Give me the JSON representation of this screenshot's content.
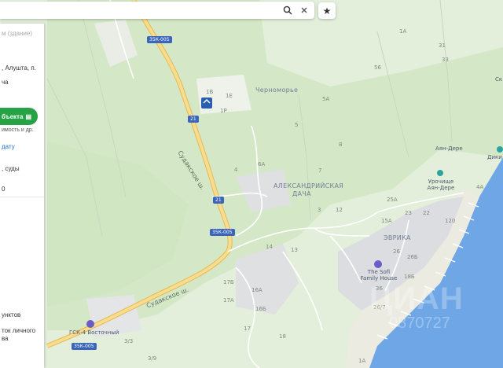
{
  "search": {
    "value": "",
    "placeholder": ""
  },
  "panel": {
    "address_placeholder": "м (здание)",
    "address_line1": ", Алушта, п.",
    "address_line2": "ча",
    "cta_label": "бъекта",
    "cta_sub": "имость и др.",
    "link_date": "дату",
    "courts_line": ", суды",
    "zero": "0",
    "bottom1": "унктов",
    "bottom2": "ток личного",
    "bottom3": "ва"
  },
  "map": {
    "areas": [
      "Черноморье",
      "АЛЕКСАНДРИЙСКАЯ",
      "ДАЧА",
      "ЭВРИКА"
    ],
    "streets": [
      "Судакское ш.",
      "Судакское ш.",
      "Судакское ш."
    ],
    "highways": [
      "35К-005",
      "35К-005",
      "35К-005",
      "21",
      "21"
    ],
    "pois": [
      {
        "name": "Аян-Дере"
      },
      {
        "name": "Урочище Аян-Дере"
      },
      {
        "name": "The Sofi Family House"
      },
      {
        "name": "ГСК-4 Восточный"
      },
      {
        "name": "Дики"
      },
      {
        "name": "Ск"
      }
    ],
    "house_numbers": [
      "1A",
      "31",
      "33",
      "56",
      "1B",
      "1E",
      "1P",
      "5A",
      "5",
      "8",
      "7",
      "4",
      "6A",
      "3",
      "12",
      "25A",
      "23",
      "22",
      "120",
      "15A",
      "13",
      "26",
      "14",
      "26Б",
      "18Б",
      "17Б",
      "16A",
      "16Б",
      "17A",
      "17",
      "18",
      "3/3",
      "3/9",
      "4A",
      "26/7",
      "36",
      "1A"
    ],
    "colors": {
      "land": "#e6f0de",
      "forest": "#d2e7c6",
      "sea": "#6ea6e6",
      "road": "#f5d27a",
      "built": "#dcdde0",
      "accent": "#27a345"
    }
  },
  "watermark": {
    "line1": "ЦИАН",
    "line2": "0870727"
  }
}
